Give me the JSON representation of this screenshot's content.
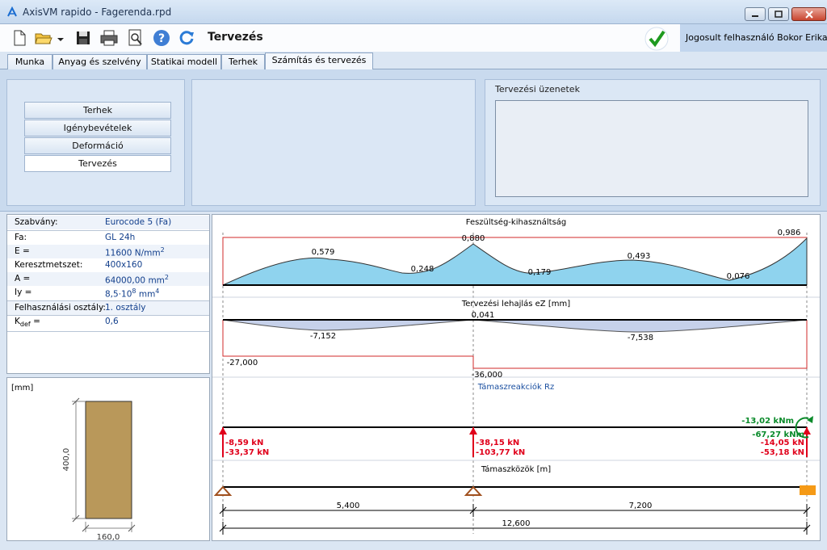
{
  "window": {
    "title": "AxisVM rapido - Fagerenda.rpd"
  },
  "toolbar": {
    "heading": "Tervezés",
    "user_label": "Jogosult felhasználó",
    "user_name": "Bokor Erika",
    "icons": [
      "new-file-icon",
      "open-folder-icon",
      "save-icon",
      "print-icon",
      "preview-icon",
      "help-icon",
      "refresh-icon",
      "check-icon"
    ]
  },
  "tabs": [
    {
      "label": "Munka",
      "active": false
    },
    {
      "label": "Anyag és szelvény",
      "active": false
    },
    {
      "label": "Statikai modell",
      "active": false
    },
    {
      "label": "Terhek",
      "active": false
    },
    {
      "label": "Számítás és tervezés",
      "active": true
    }
  ],
  "left_menu": {
    "items": [
      {
        "label": "Terhek",
        "active": false
      },
      {
        "label": "Igénybevételek",
        "active": false
      },
      {
        "label": "Deformáció",
        "active": false
      },
      {
        "label": "Tervezés",
        "active": true
      }
    ]
  },
  "messages": {
    "label": "Tervezési üzenetek"
  },
  "properties": {
    "standard_label": "Szabvány:",
    "standard_value": "Eurocode 5 (Fa)",
    "material_label": "Fa:",
    "material_value": "GL 24h",
    "e_label": "E =",
    "e_value": "11600 N/mm",
    "e_exp": "2",
    "cross_label": "Keresztmetszet:",
    "cross_value": "400x160",
    "area_label": "A =",
    "area_value": "64000,00 mm",
    "area_exp": "2",
    "iy_label": "Iy =",
    "iy_value": "8,5·10",
    "iy_exp": "8",
    "iy_unit": " mm",
    "iy_unit_exp": "4",
    "service_label": "Felhasználási osztály:",
    "service_value": "1. osztály",
    "kdef_label": "K",
    "kdef_sub": "def",
    "kdef_eq": "=",
    "kdef_value": "0,6"
  },
  "section": {
    "unit": "[mm]",
    "height": "400,0",
    "width": "160,0",
    "fill_color": "#b9985a"
  },
  "diagrams": {
    "stress": {
      "title": "Feszültség-kihasználtság",
      "labels": [
        "0,579",
        "0,248",
        "0,880",
        "0,179",
        "0,493",
        "0,076",
        "0,986"
      ]
    },
    "deflection": {
      "title": "Tervezési lehajlás eZ [mm]",
      "labels": [
        "0,041",
        "-7,152",
        "-7,538",
        "-27,000",
        "-36,000"
      ]
    },
    "reactions": {
      "title": "Támaszreakciók Rz",
      "support1": [
        "-8,59 kN",
        "-33,37 kN"
      ],
      "support2": [
        "-38,15 kN",
        "-103,77 kN"
      ],
      "moment": [
        "-13,02 kNm",
        "-67,27 kNm"
      ],
      "support3": [
        "-14,05 kN",
        "-53,18 kN"
      ]
    },
    "spans": {
      "title": "Támaszközök [m]",
      "span1": "5,400",
      "span2": "7,200",
      "total": "12,600"
    }
  },
  "colors": {
    "accent": "#1a4fa0",
    "reaction": "#e0001b",
    "moment": "#0a8a2a",
    "fill": "#8fd3ee"
  }
}
